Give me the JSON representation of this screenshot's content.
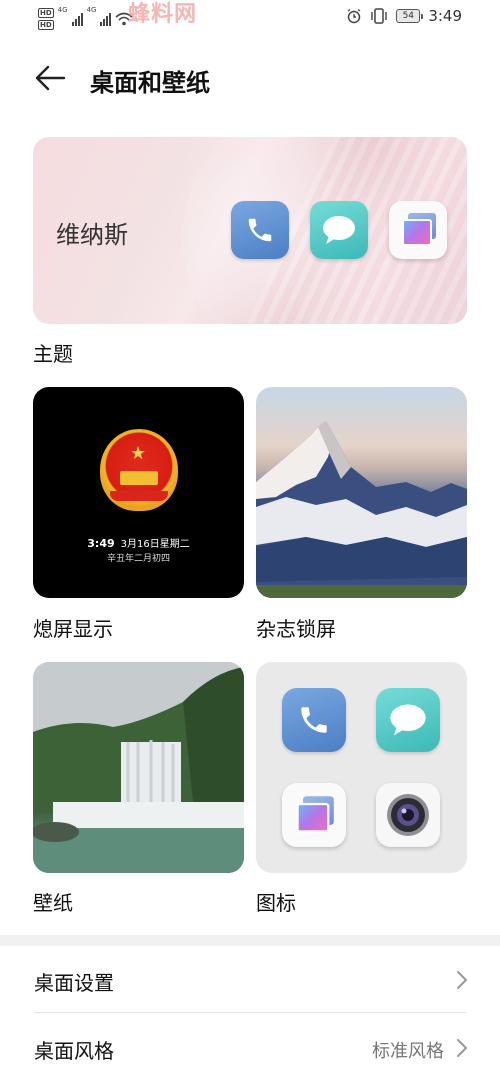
{
  "status_bar": {
    "sim1": "HD",
    "sim2": "HD",
    "net1": "4G",
    "net2": "4G",
    "watermark": "蜂料网",
    "battery": "54",
    "time": "3:49"
  },
  "header": {
    "title": "桌面和壁纸"
  },
  "theme": {
    "name": "维纳斯",
    "label": "主题",
    "icons": [
      "phone-icon",
      "message-icon",
      "gallery-icon"
    ]
  },
  "tiles": {
    "aod": {
      "label": "熄屏显示",
      "time": "3:49",
      "date": "3月16日星期二",
      "lunar": "辛丑年二月初四"
    },
    "magazine": {
      "label": "杂志锁屏"
    },
    "wallpaper": {
      "label": "壁纸"
    },
    "icons": {
      "label": "图标",
      "items": [
        "phone-icon",
        "message-icon",
        "gallery-icon",
        "camera-icon"
      ]
    }
  },
  "settings": {
    "desktop_settings": {
      "label": "桌面设置"
    },
    "desktop_style": {
      "label": "桌面风格",
      "value": "标准风格"
    }
  }
}
